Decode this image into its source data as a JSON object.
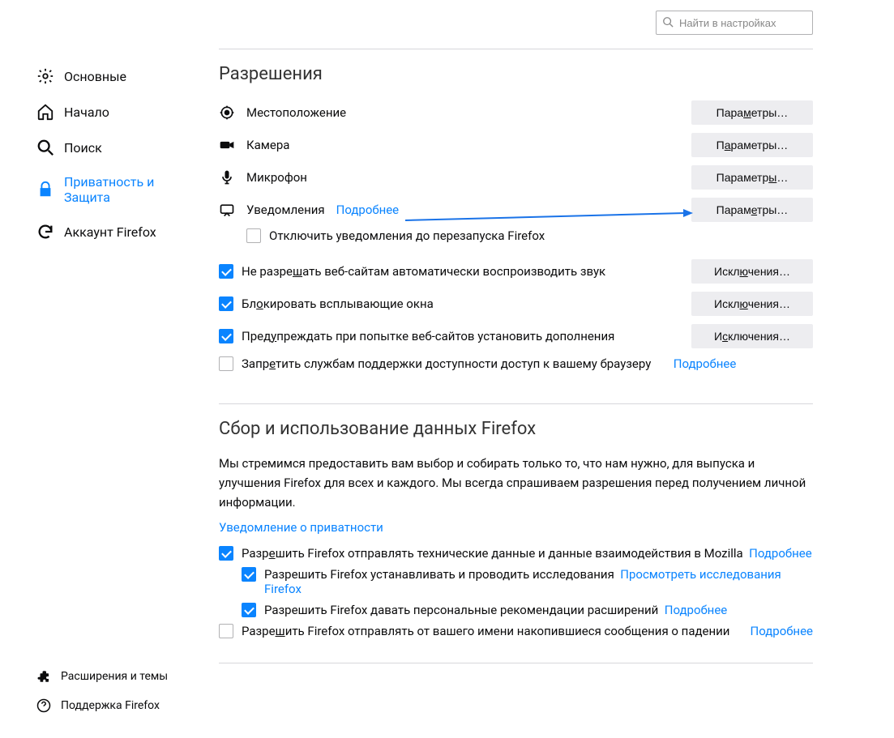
{
  "search": {
    "placeholder": "Найти в настройках"
  },
  "sidebar": {
    "items": [
      {
        "label": "Основные"
      },
      {
        "label": "Начало"
      },
      {
        "label": "Поиск"
      },
      {
        "label": "Приватность и Защита"
      },
      {
        "label": "Аккаунт Firefox"
      }
    ],
    "bottom": [
      {
        "label": "Расширения и темы"
      },
      {
        "label": "Поддержка Firefox"
      }
    ]
  },
  "permissions": {
    "title": "Разрешения",
    "location": "Местоположение",
    "camera": "Камера",
    "microphone": "Микрофон",
    "notifications": "Уведомления",
    "learn_more": "Подробнее",
    "settings_btn": "Параметры…",
    "exceptions_btn": "Исключения…",
    "disable_notifications": "Отключить уведомления до перезапуска Firefox",
    "block_autoplay": "Не разрешать веб-сайтам автоматически воспроизводить звук",
    "block_popups": "Блокировать всплывающие окна",
    "warn_addon": "Предупреждать при попытке веб-сайтов установить дополнения",
    "block_a11y": "Запретить службам поддержки доступности доступ к вашему браузеру"
  },
  "data": {
    "title": "Сбор и использование данных Firefox",
    "desc": "Мы стремимся предоставить вам выбор и собирать только то, что нам нужно, для выпуска и улучшения Firefox для всех и каждого. Мы всегда спрашиваем разрешения перед получением личной информации.",
    "privacy_notice": "Уведомление о приватности",
    "telemetry": "Разрешить Firefox отправлять технические данные и данные взаимодействия в Mozilla",
    "studies": "Разрешить Firefox устанавливать и проводить исследования",
    "view_studies": "Просмотреть исследования Firefox",
    "recommendations": "Разрешить Firefox давать персональные рекомендации расширений",
    "crash_reports": "Разрешить Firefox отправлять от вашего имени накопившиеся сообщения о падении",
    "learn_more": "Подробнее"
  }
}
